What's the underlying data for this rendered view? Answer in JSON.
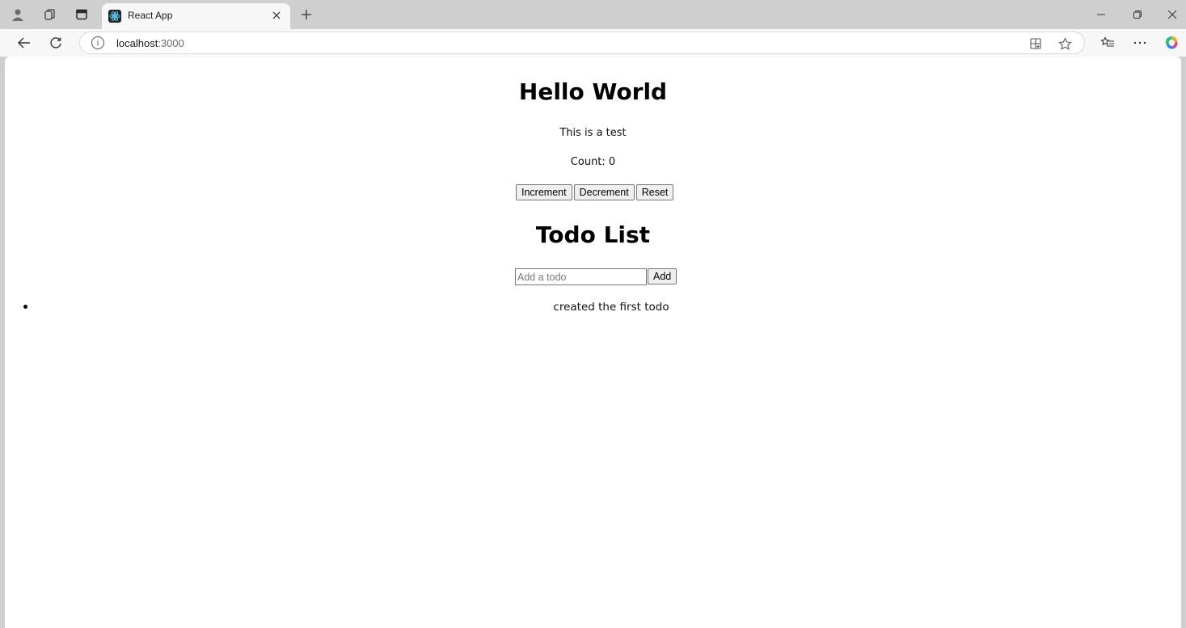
{
  "browser": {
    "tab": {
      "title": "React App"
    },
    "address": {
      "host": "localhost",
      "port": ":3000"
    }
  },
  "page": {
    "heading": "Hello World",
    "subtitle": "This is a test",
    "count_text": "Count: 0",
    "buttons": {
      "increment": "Increment",
      "decrement": "Decrement",
      "reset": "Reset"
    },
    "todo_heading": "Todo List",
    "todo_input": {
      "placeholder": "Add a todo",
      "value": ""
    },
    "add_label": "Add",
    "todos": [
      "created the first todo"
    ]
  },
  "colors": {
    "favicon_bg": "#20232a",
    "favicon_fg": "#61dafb",
    "copilot_gradient": "#f5a623"
  }
}
